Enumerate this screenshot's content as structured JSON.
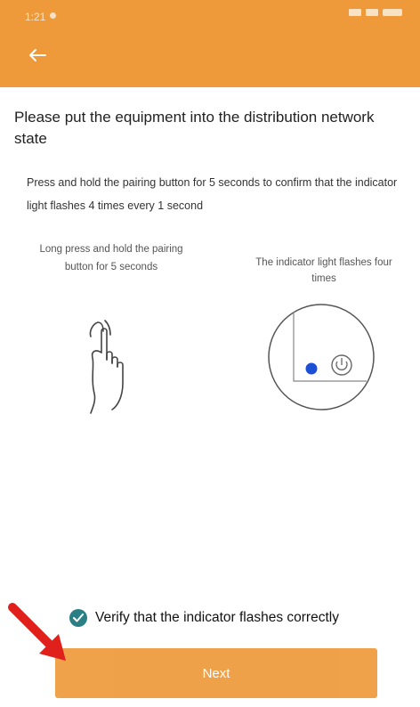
{
  "status_bar": {
    "time": "1:21"
  },
  "page": {
    "title": "Please put the equipment into the distribution network state",
    "description": "Press and hold the pairing button for 5 seconds to confirm that the indicator light flashes 4 times every 1 second"
  },
  "steps": {
    "left_label": "Long press and hold the pairing button for 5 seconds",
    "right_label": "The indicator light flashes four times"
  },
  "verify": {
    "label": "Verify that the indicator flashes correctly",
    "checked": true
  },
  "footer": {
    "next_label": "Next"
  },
  "colors": {
    "brand": "#ee9a3a",
    "check": "#2a7f85",
    "indicator": "#1a4fd6",
    "annotation_arrow": "#e0201b"
  },
  "icons": {
    "back": "arrow-left-icon",
    "hand": "hand-press-icon",
    "device": "device-indicator-icon",
    "check": "check-circle-icon",
    "annotation": "red-arrow-icon"
  }
}
